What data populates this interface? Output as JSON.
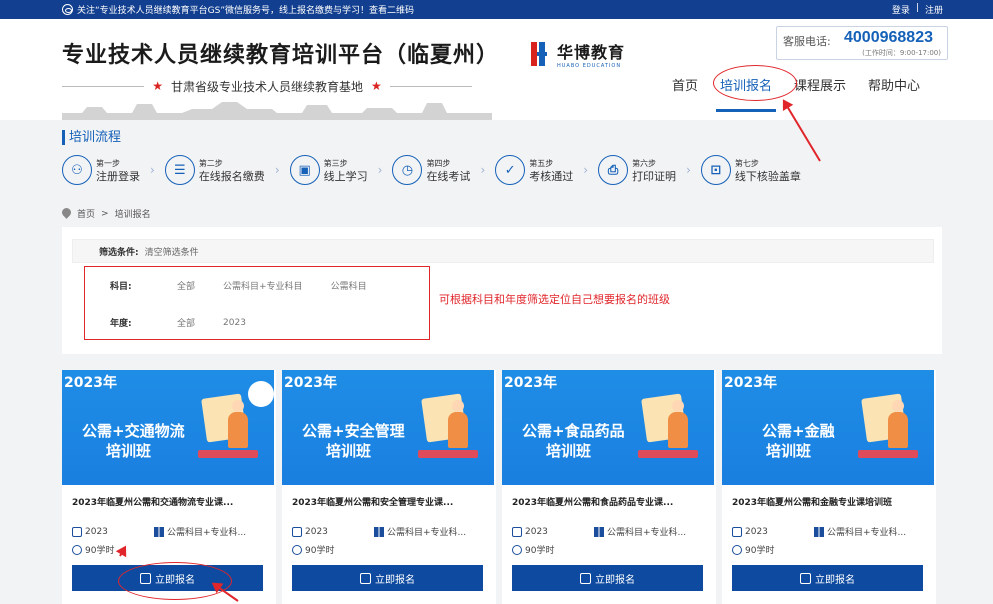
{
  "topbar": {
    "notice": "关注“专业技术人员继续教育平台GS”微信服务号，线上报名缴费与学习！查看二维码",
    "login": "登录",
    "sep": "|",
    "register": "注册"
  },
  "header": {
    "site_title": "专业技术人员继续教育培训平台（临夏州）",
    "subtitle": "甘肃省级专业技术人员继续教育基地",
    "logo_cn": "华博教育",
    "logo_en": "HUABO EDUCATION",
    "hotline_label": "客服电话:",
    "hotline_number": "4000968823",
    "hotline_hours": "(工作时间：9:00-17:00)"
  },
  "nav": {
    "items": [
      {
        "label": "首页"
      },
      {
        "label": "培训报名"
      },
      {
        "label": "课程展示"
      },
      {
        "label": "帮助中心"
      }
    ]
  },
  "process": {
    "title": "培训流程",
    "steps": [
      {
        "no": "第一步",
        "label": "注册登录",
        "icon": "user-icon"
      },
      {
        "no": "第二步",
        "label": "在线报名缴费",
        "icon": "list-icon"
      },
      {
        "no": "第三步",
        "label": "线上学习",
        "icon": "monitor-icon"
      },
      {
        "no": "第四步",
        "label": "在线考试",
        "icon": "clock-icon"
      },
      {
        "no": "第五步",
        "label": "考核通过",
        "icon": "check-doc-icon"
      },
      {
        "no": "第六步",
        "label": "打印证明",
        "icon": "printer-icon"
      },
      {
        "no": "第七步",
        "label": "线下核验盖章",
        "icon": "stamp-icon"
      }
    ]
  },
  "breadcrumb": {
    "home": "首页",
    "sep": ">",
    "current": "培训报名"
  },
  "filter": {
    "cond_label": "筛选条件:",
    "clear": "清空筛选条件",
    "subject_label": "科目:",
    "subject_options": [
      "全部",
      "公需科目+专业科目",
      "公需科目"
    ],
    "year_label": "年度:",
    "year_options": [
      "全部",
      "2023"
    ],
    "annotation": "可根据科目和年度筛选定位自己想要报名的班级"
  },
  "cards": [
    {
      "year_tag": "2023年",
      "line1": "公需+交通物流",
      "line2": "培训班",
      "title": "2023年临夏州公需和交通物流专业课...",
      "year": "2023",
      "category": "公需科目+专业科...",
      "hours": "90学时",
      "button": "立即报名"
    },
    {
      "year_tag": "2023年",
      "line1": "公需+安全管理",
      "line2": "培训班",
      "title": "2023年临夏州公需和安全管理专业课...",
      "year": "2023",
      "category": "公需科目+专业科...",
      "hours": "90学时",
      "button": "立即报名"
    },
    {
      "year_tag": "2023年",
      "line1": "公需+食品药品",
      "line2": "培训班",
      "title": "2023年临夏州公需和食品药品专业课...",
      "year": "2023",
      "category": "公需科目+专业科...",
      "hours": "90学时",
      "button": "立即报名"
    },
    {
      "year_tag": "2023年",
      "line1": "公需+金融",
      "line2": "培训班",
      "title": "2023年临夏州公需和金融专业课培训班",
      "year": "2023",
      "category": "公需科目+专业科...",
      "hours": "90学时",
      "button": "立即报名"
    }
  ],
  "colors": {
    "primary": "#1561b8",
    "topbar": "#123f8f",
    "button": "#0d4aa0",
    "annotation_red": "#e0262b"
  }
}
